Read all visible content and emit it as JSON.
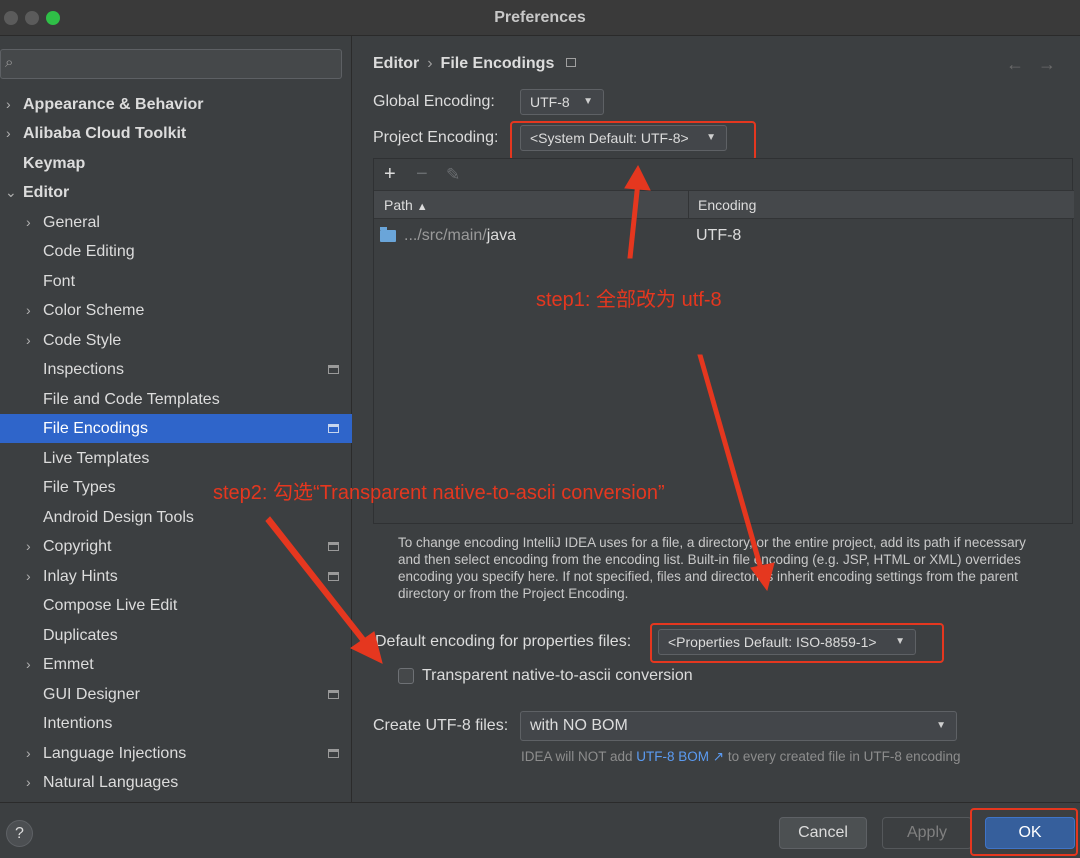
{
  "window": {
    "title": "Preferences"
  },
  "sidebar": {
    "search_placeholder": "",
    "items": [
      {
        "label": "Appearance & Behavior",
        "chevron": "›"
      },
      {
        "label": "Alibaba Cloud Toolkit",
        "chevron": "›"
      },
      {
        "label": "Keymap"
      },
      {
        "label": "Editor",
        "chevron": "⌄"
      },
      {
        "label": "General",
        "chevron": "›"
      },
      {
        "label": "Code Editing"
      },
      {
        "label": "Font"
      },
      {
        "label": "Color Scheme",
        "chevron": "›"
      },
      {
        "label": "Code Style",
        "chevron": "›"
      },
      {
        "label": "Inspections"
      },
      {
        "label": "File and Code Templates"
      },
      {
        "label": "File Encodings"
      },
      {
        "label": "Live Templates"
      },
      {
        "label": "File Types"
      },
      {
        "label": "Android Design Tools"
      },
      {
        "label": "Copyright",
        "chevron": "›"
      },
      {
        "label": "Inlay Hints",
        "chevron": "›"
      },
      {
        "label": "Compose Live Edit"
      },
      {
        "label": "Duplicates"
      },
      {
        "label": "Emmet",
        "chevron": "›"
      },
      {
        "label": "GUI Designer"
      },
      {
        "label": "Intentions"
      },
      {
        "label": "Language Injections",
        "chevron": "›"
      },
      {
        "label": "Natural Languages",
        "chevron": "›"
      }
    ],
    "selected": "File Encodings"
  },
  "main": {
    "breadcrumb": {
      "parent": "Editor",
      "separator": "›",
      "current": "File Encodings"
    },
    "nav": {
      "back": "←",
      "forward": "→"
    },
    "global_encoding": {
      "label": "Global Encoding:",
      "value": "UTF-8"
    },
    "project_encoding": {
      "label": "Project Encoding:",
      "value": "<System Default: UTF-8>"
    },
    "table": {
      "add": "+",
      "remove": "−",
      "edit": "✎",
      "columns": {
        "path": "Path",
        "sort": "▲",
        "encoding": "Encoding"
      },
      "rows": [
        {
          "path_prefix": ".../src/main/",
          "path_name": "java",
          "encoding": "UTF-8"
        }
      ]
    },
    "help_text": "To change encoding IntelliJ IDEA uses for a file, a directory, or the entire project, add its path if necessary and then select encoding from the encoding list. Built-in file encoding (e.g. JSP, HTML or XML) overrides encoding you specify here. If not specified, files and directories inherit encoding settings from the parent directory or from the Project Encoding.",
    "properties_encoding": {
      "label": "Default encoding for properties files:",
      "value": "<Properties Default: ISO-8859-1>"
    },
    "transparent_checkbox": {
      "label": "Transparent native-to-ascii conversion",
      "checked": false
    },
    "create_utf8": {
      "label": "Create UTF-8 files:",
      "value": "with NO BOM"
    },
    "bom_note": {
      "prefix": "IDEA will NOT add ",
      "link": "UTF-8 BOM ↗",
      "suffix": " to every created file in UTF-8 encoding"
    }
  },
  "footer": {
    "help": "?",
    "cancel": "Cancel",
    "apply": "Apply",
    "ok": "OK"
  },
  "annotations": {
    "step1": "step1: 全部改为 utf-8",
    "step2": "step2: 勾选“Transparent native-to-ascii conversion”"
  },
  "colors": {
    "selection": "#2f65ca",
    "annotation": "#e5371f",
    "link": "#5b9bf2"
  }
}
